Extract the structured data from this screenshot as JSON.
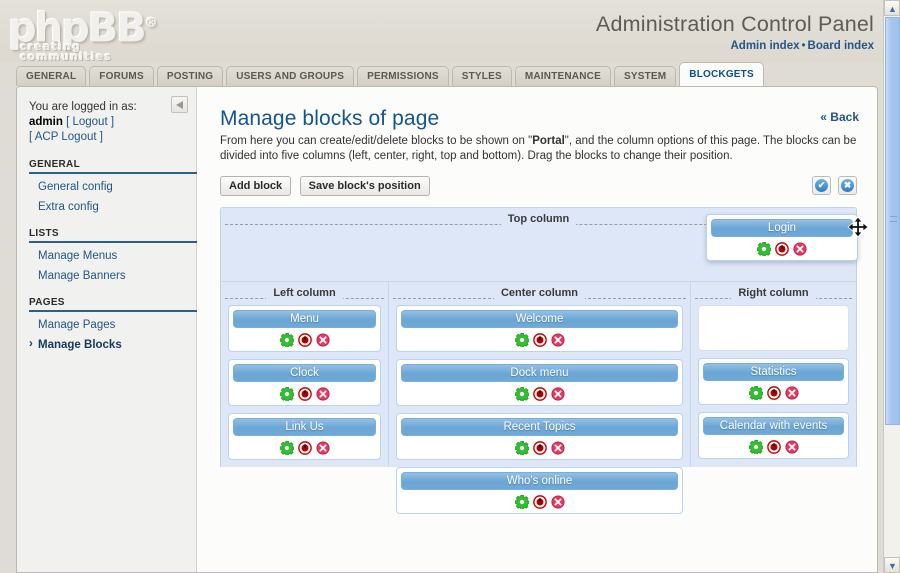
{
  "header": {
    "logo_text": "phpBB",
    "logo_reg": "®",
    "logo_tagline": "creating communities",
    "title": "Administration Control Panel",
    "link_admin_index": "Admin index",
    "link_separator": "•",
    "link_board_index": "Board index"
  },
  "tabs": [
    {
      "label": "GENERAL",
      "active": false
    },
    {
      "label": "FORUMS",
      "active": false
    },
    {
      "label": "POSTING",
      "active": false
    },
    {
      "label": "USERS AND GROUPS",
      "active": false
    },
    {
      "label": "PERMISSIONS",
      "active": false
    },
    {
      "label": "STYLES",
      "active": false
    },
    {
      "label": "MAINTENANCE",
      "active": false
    },
    {
      "label": "SYSTEM",
      "active": false
    },
    {
      "label": "BLOCKGETS",
      "active": true
    }
  ],
  "sidebar": {
    "logged_in_label": "You are logged in as:",
    "username": "admin",
    "logout_label": "[ Logout ]",
    "acp_logout_label": "[ ACP Logout ]",
    "sections": [
      {
        "heading": "GENERAL",
        "items": [
          {
            "label": "General config",
            "current": false
          },
          {
            "label": "Extra config",
            "current": false
          }
        ]
      },
      {
        "heading": "LISTS",
        "items": [
          {
            "label": "Manage Menus",
            "current": false
          },
          {
            "label": "Manage Banners",
            "current": false
          }
        ]
      },
      {
        "heading": "PAGES",
        "items": [
          {
            "label": "Manage Pages",
            "current": false
          },
          {
            "label": "Manage Blocks",
            "current": true
          }
        ]
      }
    ]
  },
  "content": {
    "back_label": "« Back",
    "page_title": "Manage blocks of page",
    "desc_part1": "From here you can create/edit/delete blocks to be shown on \"",
    "desc_bold": "Portal",
    "desc_part2": "\", and the column options of this page. The blocks can be divided into five columns (left, center, right, top and bottom). Drag the blocks to change their position.",
    "btn_add_block": "Add block",
    "btn_save_position": "Save block's position",
    "btn_ok_glyph": "✔",
    "btn_cancel_glyph": "✖"
  },
  "grid": {
    "top_column_label": "Top column",
    "left_column_label": "Left column",
    "center_column_label": "Center column",
    "right_column_label": "Right column",
    "icons": {
      "settings": "gear-icon",
      "toggle": "toggle-icon",
      "delete": "delete-icon"
    },
    "top_blocks": [],
    "left_blocks": [
      {
        "title": "Menu"
      },
      {
        "title": "Clock"
      },
      {
        "title": "Link Us"
      }
    ],
    "center_blocks": [
      {
        "title": "Welcome"
      },
      {
        "title": "Dock menu"
      },
      {
        "title": "Recent Topics"
      },
      {
        "title": "Who's online"
      }
    ],
    "right_blocks": [
      {
        "title": "Statistics"
      },
      {
        "title": "Calendar with events"
      }
    ],
    "dragging_block": {
      "title": "Login"
    }
  },
  "colors": {
    "accent_blue": "#14558e",
    "link_blue": "#22568a",
    "block_header": "#6ba5d4",
    "grid_bg": "#dde7f7",
    "page_bg": "#dedcd5",
    "gear_green": "#33cc33",
    "toggle_red": "#cc0000",
    "delete_pink": "#e8365e"
  },
  "scrollbar": {
    "up_glyph": "▲",
    "down_glyph": "▼"
  }
}
